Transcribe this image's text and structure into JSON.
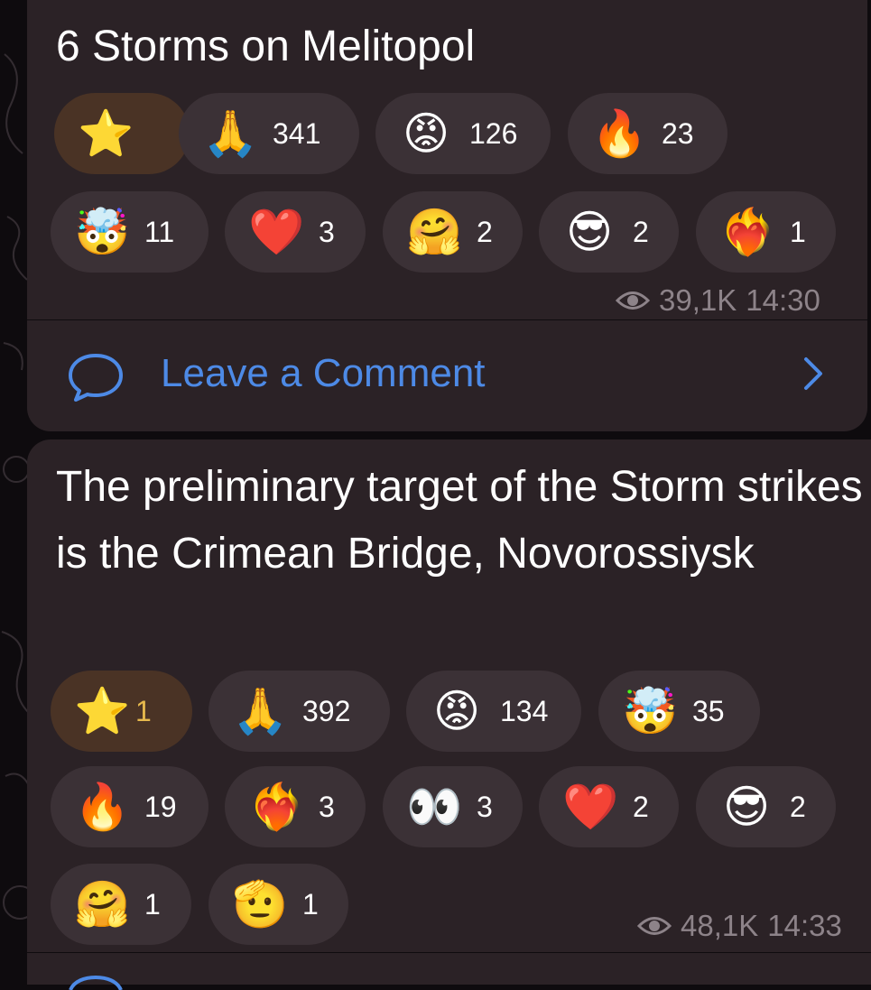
{
  "messages": [
    {
      "text": "6 Storms on Melitopol",
      "reactions": [
        {
          "emoji": "⭐",
          "count": "",
          "icon": "star-icon"
        },
        {
          "emoji": "🙏",
          "count": "341",
          "icon": "folded-hands-icon"
        },
        {
          "emoji": "😡",
          "count": "126",
          "icon": "cursing-face-icon"
        },
        {
          "emoji": "🔥",
          "count": "23",
          "icon": "fire-icon"
        },
        {
          "emoji": "🤯",
          "count": "11",
          "icon": "exploding-head-icon"
        },
        {
          "emoji": "❤️",
          "count": "3",
          "icon": "red-heart-icon"
        },
        {
          "emoji": "🤗",
          "count": "2",
          "icon": "hugging-face-icon"
        },
        {
          "emoji": "😎",
          "count": "2",
          "icon": "sunglasses-face-icon"
        },
        {
          "emoji": "❤️‍🔥",
          "count": "1",
          "icon": "heart-on-fire-icon"
        }
      ],
      "views": "39,1K",
      "time": "14:30",
      "comment_label": "Leave a Comment"
    },
    {
      "text": "The preliminary target of the Storm strikes is the Crimean Bridge, Novorossiysk",
      "reactions": [
        {
          "emoji": "⭐",
          "count": "1",
          "icon": "star-icon"
        },
        {
          "emoji": "🙏",
          "count": "392",
          "icon": "folded-hands-icon"
        },
        {
          "emoji": "😡",
          "count": "134",
          "icon": "cursing-face-icon"
        },
        {
          "emoji": "🤯",
          "count": "35",
          "icon": "exploding-head-icon"
        },
        {
          "emoji": "🔥",
          "count": "19",
          "icon": "fire-icon"
        },
        {
          "emoji": "❤️‍🔥",
          "count": "3",
          "icon": "heart-on-fire-icon"
        },
        {
          "emoji": "👀",
          "count": "3",
          "icon": "eyes-icon"
        },
        {
          "emoji": "❤️",
          "count": "2",
          "icon": "red-heart-icon"
        },
        {
          "emoji": "😎",
          "count": "2",
          "icon": "sunglasses-face-icon"
        },
        {
          "emoji": "🤗",
          "count": "1",
          "icon": "hugging-face-icon"
        },
        {
          "emoji": "🫡",
          "count": "1",
          "icon": "saluting-face-icon"
        }
      ],
      "views": "48,1K",
      "time": "14:33"
    }
  ],
  "colors": {
    "bubble": "#2b2226",
    "pill": "#3b3136",
    "star_pill": "#4a3325",
    "accent": "#4d8ae6",
    "meta": "#8d8389"
  }
}
